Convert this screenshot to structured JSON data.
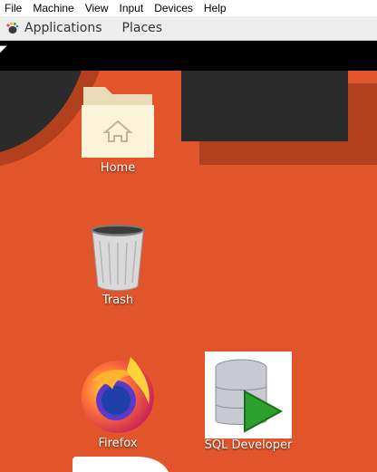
{
  "host_menu": {
    "items": [
      "File",
      "Machine",
      "View",
      "Input",
      "Devices",
      "Help"
    ]
  },
  "panel": {
    "applications": "Applications",
    "places": "Places",
    "applications_icon": "gnome-foot-icon"
  },
  "desktop": {
    "icons": [
      {
        "label": "Home",
        "icon": "home-folder-icon"
      },
      {
        "label": "Trash",
        "icon": "trash-icon"
      },
      {
        "label": "Firefox",
        "icon": "firefox-icon"
      },
      {
        "label": "SQL Developer",
        "icon": "sql-developer-icon"
      }
    ]
  },
  "colors": {
    "wallpaper": "#e2552b",
    "wallpaper_shadow": "#b3401c",
    "dark_shape": "#2b2b2b",
    "panel": "#ededed"
  }
}
